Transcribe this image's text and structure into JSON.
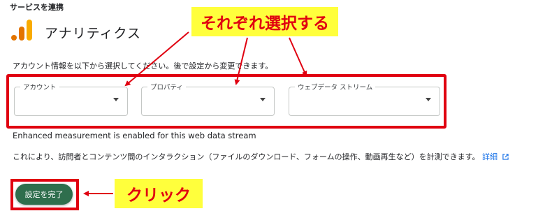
{
  "section_title": "サービスを連携",
  "app": {
    "name": "アナリティクス",
    "logo_icon": "google-analytics-logo"
  },
  "instruction": "アカウント情報を以下から選択してください。後で設定から変更できます。",
  "fields": [
    {
      "label": "アカウント",
      "value": ""
    },
    {
      "label": "プロパティ",
      "value": ""
    },
    {
      "label": "ウェブデータ ストリーム",
      "value": ""
    }
  ],
  "measurement_text": "Enhanced measurement is enabled for this web data stream",
  "description": "これにより、訪問者とコンテンツ間のインタラクション（ファイルのダウンロード、フォームの操作、動画再生など）を計測できます。",
  "details_link": "詳細",
  "done_button": "設定を完了",
  "annotations": {
    "select_each": "それぞれ選択する",
    "click": "クリック",
    "highlight_color": "#e00010",
    "callout_bg": "#ffff3c"
  },
  "colors": {
    "button_green": "#2f6e4d",
    "link_blue": "#1a73e8"
  }
}
